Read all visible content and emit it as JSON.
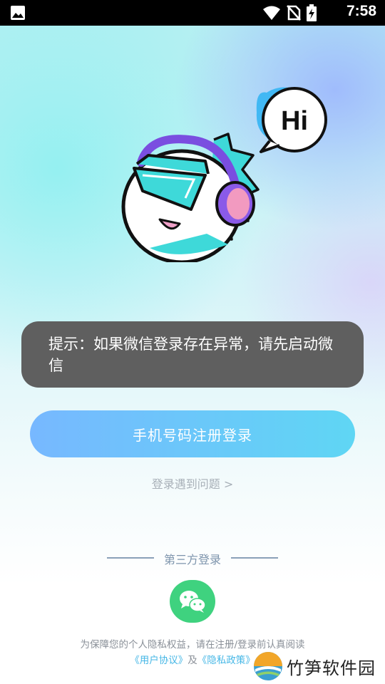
{
  "status_bar": {
    "time": "7:58"
  },
  "toast": {
    "text": "提示：如果微信登录存在异常，请先启动微信"
  },
  "mascot": {
    "speech": "Hi"
  },
  "login": {
    "phone_button": "手机号码注册登录",
    "help_link": "登录遇到问题 >"
  },
  "third_party": {
    "label": "第三方登录"
  },
  "privacy": {
    "prefix": "为保障您的个人隐私权益，请在注册/登录前认真阅读",
    "user_agreement": "《用户协议》",
    "and": "及",
    "privacy_policy": "《隐私政策》"
  },
  "watermark": {
    "text": "竹笋软件园"
  },
  "colors": {
    "accent_start": "#77b8ff",
    "accent_end": "#5fd6f4",
    "wechat": "#3fd27f",
    "link": "#46b7e6"
  }
}
